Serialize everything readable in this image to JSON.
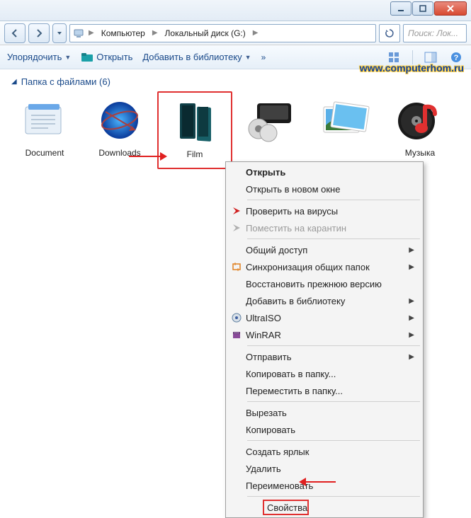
{
  "breadcrumb": {
    "computer": "Компьютер",
    "disk": "Локальный диск (G:)"
  },
  "search": {
    "placeholder": "Поиск: Лок..."
  },
  "toolbar": {
    "organize": "Упорядочить",
    "open": "Открыть",
    "addlib": "Добавить в библиотеку",
    "chev": "»"
  },
  "group": {
    "header": "Папка с файлами (6)"
  },
  "items": {
    "0": {
      "label": "Document"
    },
    "1": {
      "label": "Downloads"
    },
    "2": {
      "label": "Film"
    },
    "3": {
      "label": ""
    },
    "4": {
      "label": ""
    },
    "5": {
      "label": "Музыка"
    }
  },
  "ctx": {
    "open": "Открыть",
    "openwin": "Открыть в новом окне",
    "scan": "Проверить на вирусы",
    "quarantine": "Поместить на карантин",
    "share": "Общий доступ",
    "sync": "Синхронизация общих папок",
    "restore": "Восстановить прежнюю версию",
    "addlib": "Добавить в библиотеку",
    "ultraiso": "UltraISO",
    "winrar": "WinRAR",
    "send": "Отправить",
    "copyto": "Копировать в папку...",
    "moveto": "Переместить в папку...",
    "cut": "Вырезать",
    "copy": "Копировать",
    "shortcut": "Создать ярлык",
    "delete": "Удалить",
    "rename": "Переименовать",
    "props": "Свойства"
  },
  "watermark": "www.computerhom.ru"
}
